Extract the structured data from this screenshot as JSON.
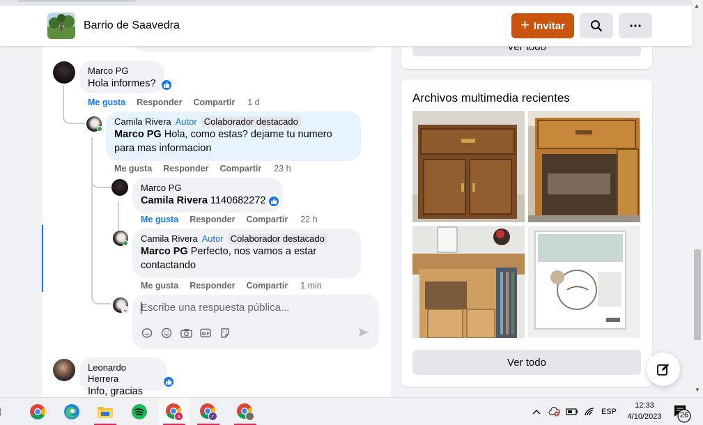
{
  "header": {
    "group_name": "Barrio de Saavedra",
    "invite_label": "Invitar"
  },
  "comments": [
    {
      "author": "Marco PG",
      "text": "Hola informes?",
      "actions": {
        "like": "Me gusta",
        "reply": "Responder",
        "share": "Compartir",
        "time": "1 d"
      }
    },
    {
      "author": "Camila Rivera",
      "author_badge": "Autor",
      "role_badge": "Colaborador destacado",
      "mention": "Marco PG",
      "text": "Hola, como estas? dejame tu numero para mas informacion",
      "actions": {
        "like": "Me gusta",
        "reply": "Responder",
        "share": "Compartir",
        "time": "23 h"
      }
    },
    {
      "author": "Marco PG",
      "mention": "Camila Rivera",
      "text": "1140682272",
      "actions": {
        "like": "Me gusta",
        "reply": "Responder",
        "share": "Compartir",
        "time": "22 h"
      }
    },
    {
      "author": "Camila Rivera",
      "author_badge": "Autor",
      "role_badge": "Colaborador destacado",
      "mention": "Marco PG",
      "text": "Perfecto, nos vamos a estar contactando",
      "actions": {
        "like": "Me gusta",
        "reply": "Responder",
        "share": "Compartir",
        "time": "1 min"
      }
    },
    {
      "author": "Leonardo Herrera",
      "text": "Info, gracias"
    }
  ],
  "reply_box": {
    "placeholder": "Escribe una respuesta pública..."
  },
  "sidebar": {
    "prev_card_button": "Ver todo",
    "media_title": "Archivos multimedia recientes",
    "media_button": "Ver todo"
  },
  "taskbar": {
    "language": "ESP",
    "time": "12:33",
    "date": "4/10/2023",
    "notifications": "26"
  },
  "colors": {
    "accent": "#1877f2",
    "invite": "#c9540f"
  }
}
